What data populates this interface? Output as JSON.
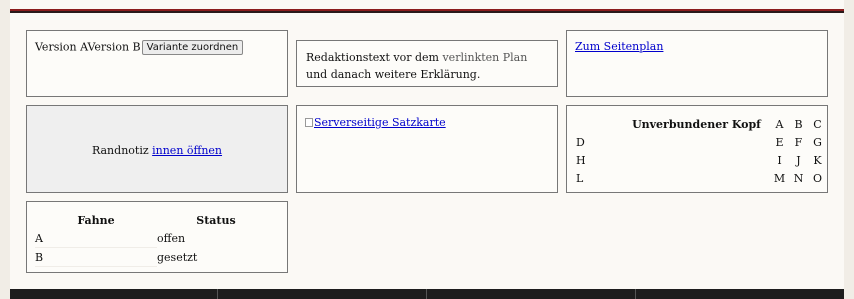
{
  "variant_card": {
    "label_a": "Version A",
    "label_b": "Version B",
    "button_label": "Variante zuordnen"
  },
  "editorial_card": {
    "text_before": "Redaktionstext vor dem ",
    "link_text": "verlinkten Plan",
    "text_after": " und danach weitere Erklärung."
  },
  "sitemap_card": {
    "link_text": "Zum Seitenplan"
  },
  "note_card": {
    "text": "Randnotiz ",
    "link_text": "innen öffnen"
  },
  "image_card": {
    "alt_text": "Serverseitige Satzkarte"
  },
  "unbound_table": {
    "header": "Unverbundener Kopf",
    "header_cols": [
      "A",
      "B",
      "C"
    ],
    "rows": [
      {
        "label": "D",
        "cells": [
          "E",
          "F",
          "G"
        ]
      },
      {
        "label": "H",
        "cells": [
          "I",
          "J",
          "K"
        ]
      },
      {
        "label": "L",
        "cells": [
          "M",
          "N",
          "O"
        ]
      }
    ]
  },
  "flag_table": {
    "headers": [
      "Fahne",
      "Status"
    ],
    "rows": [
      {
        "flag": "A",
        "status": "offen"
      },
      {
        "flag": "B",
        "status": "gesetzt"
      }
    ]
  }
}
